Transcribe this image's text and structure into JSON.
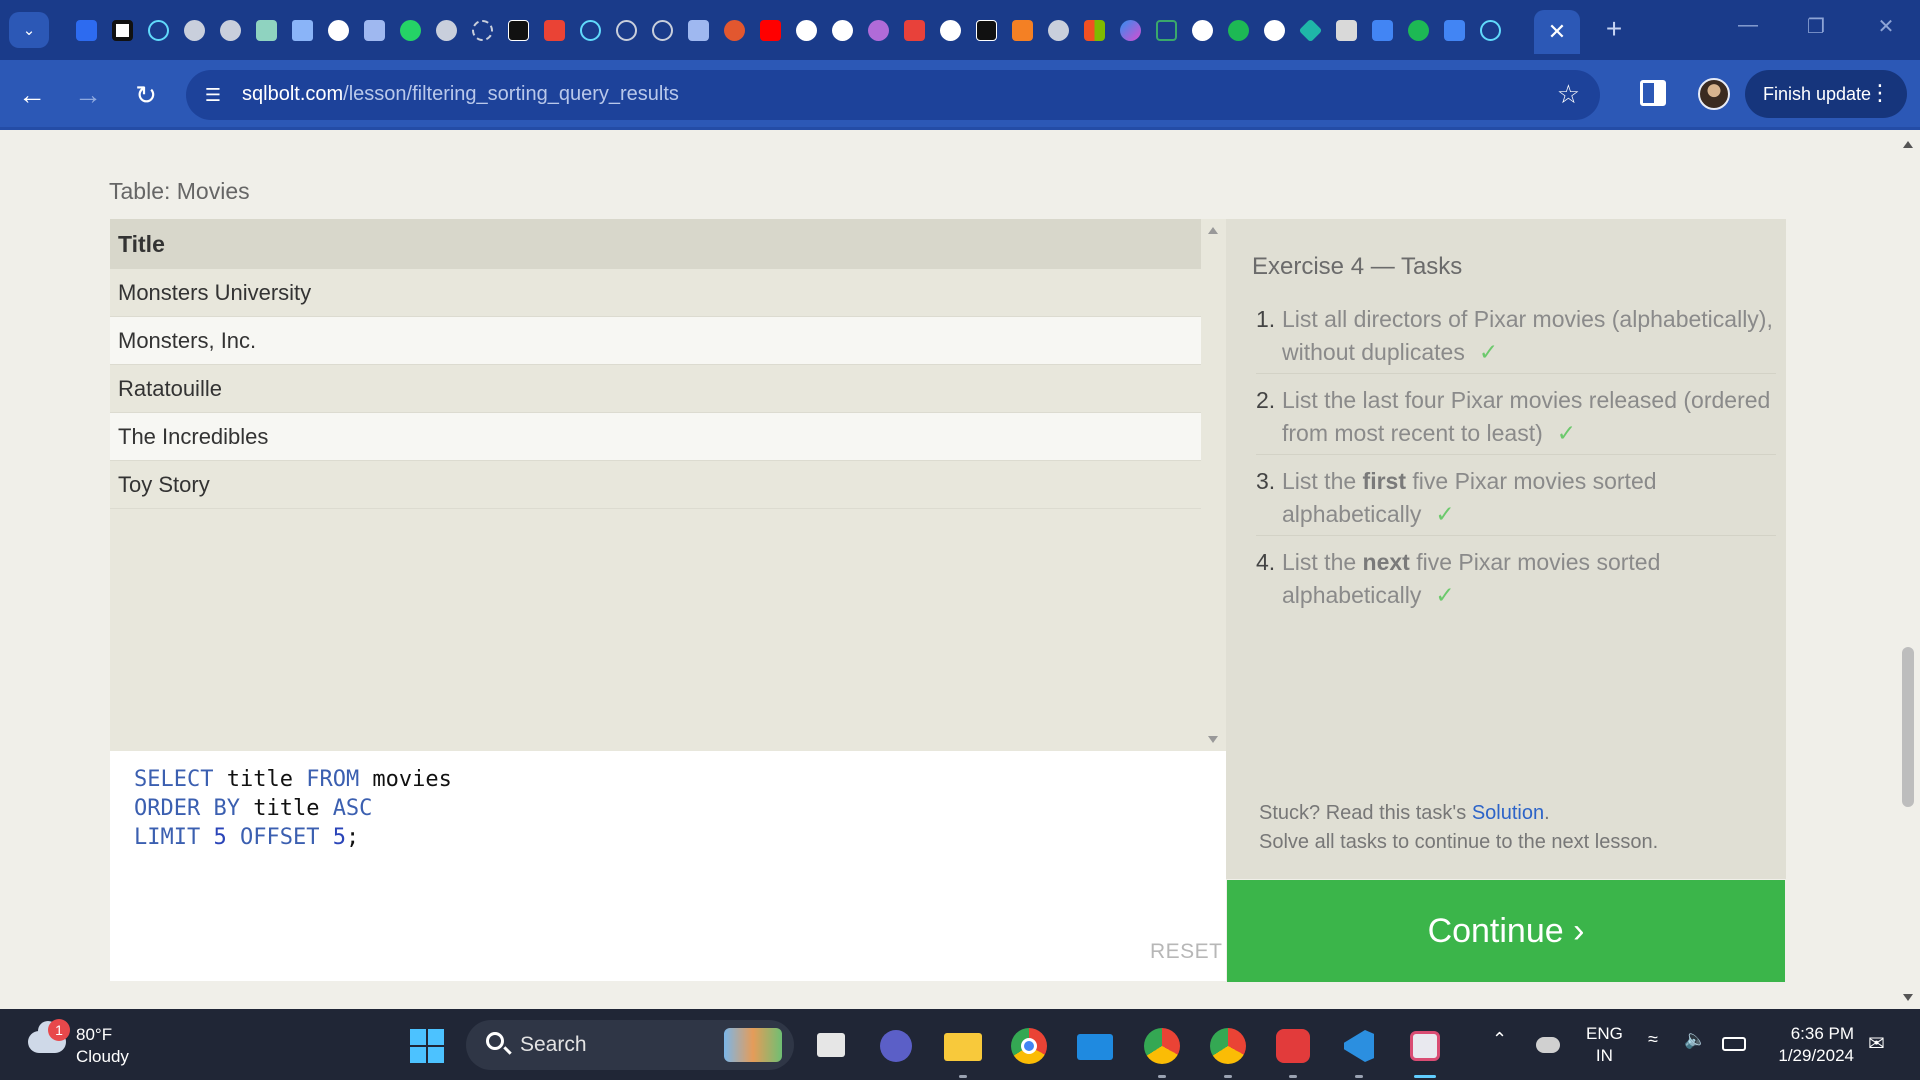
{
  "browser": {
    "url_domain": "sqlbolt.com",
    "url_path": "/lesson/filtering_sorting_query_results",
    "finish_update_label": "Finish update",
    "active_tab_close": "✕",
    "new_tab": "+",
    "menu_dots": "⋮"
  },
  "page": {
    "table_caption": "Table: Movies",
    "results": {
      "header": "Title",
      "rows": [
        "Monsters University",
        "Monsters, Inc.",
        "Ratatouille",
        "The Incredibles",
        "Toy Story"
      ]
    },
    "query": {
      "line1": {
        "kw1": "SELECT",
        "ident1": " title ",
        "kw2": "FROM",
        "ident2": " movies"
      },
      "line2": {
        "kw1": "ORDER BY",
        "ident1": " title ",
        "kw2": "ASC"
      },
      "line3": {
        "kw1": "LIMIT",
        "num1": " 5",
        "kw2": " OFFSET",
        "num2": " 5",
        "end": ";"
      }
    },
    "reset_label": "RESET",
    "exercise_title": "Exercise 4 — Tasks",
    "tasks": [
      {
        "number": "1.",
        "pre": "List all directors of Pixar movies (alphabetically), without duplicates",
        "em": "",
        "post": "",
        "check": "✓"
      },
      {
        "number": "2.",
        "pre": "List the last four Pixar movies released (ordered from most recent to least)",
        "em": "",
        "post": "",
        "check": "✓"
      },
      {
        "number": "3.",
        "pre": "List the ",
        "em": "first",
        "post": " five Pixar movies sorted alphabetically",
        "check": "✓"
      },
      {
        "number": "4.",
        "pre": "List the ",
        "em": "next",
        "post": " five Pixar movies sorted alphabetically",
        "check": "✓"
      }
    ],
    "stuck_prefix": "Stuck? Read this task's ",
    "stuck_link": "Solution",
    "stuck_suffix": ".",
    "solve_all": "Solve all tasks to continue to the next lesson.",
    "continue_label": "Continue ›"
  },
  "taskbar": {
    "weather_badge": "1",
    "temperature": "80°F",
    "condition": "Cloudy",
    "search_label": "Search",
    "language": "ENG",
    "region": "IN",
    "time": "6:36 PM",
    "date": "1/29/2024"
  },
  "colors": {
    "tabstrip": "#1a3b8a",
    "toolbar": "#2c58b6",
    "continue_button": "#3bb54a",
    "check": "#6cc96c",
    "sql_keyword": "#3b5fb0",
    "link": "#2d64c8"
  }
}
